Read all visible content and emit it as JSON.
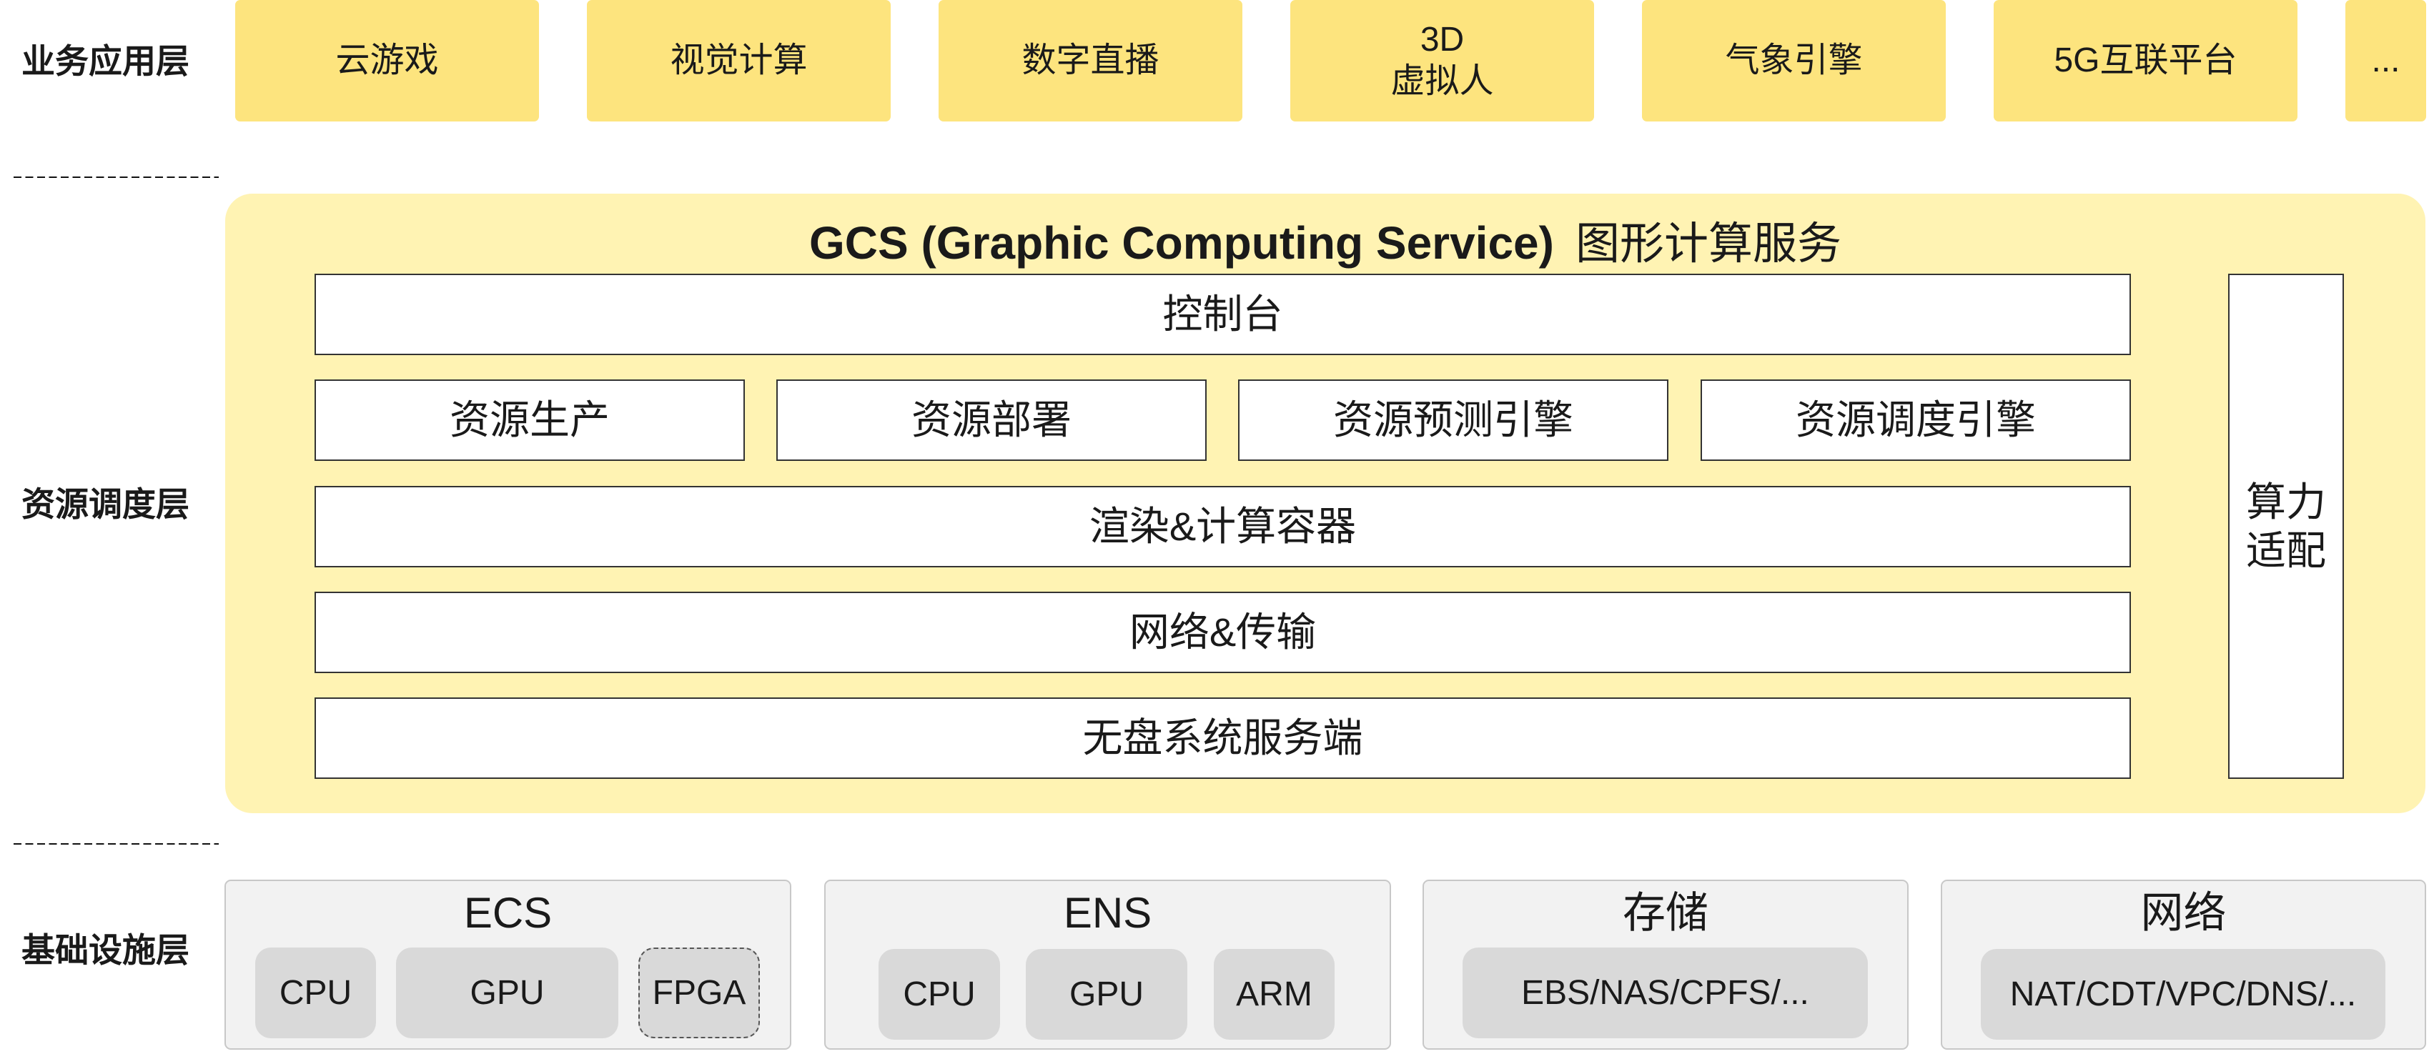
{
  "colors": {
    "app_box": "#FDE47E",
    "panel": "#FFF3B3",
    "module_fill": "#FFFFFF",
    "module_border": "#333333",
    "infra_box": "#F2F2F2",
    "infra_border": "#C8C8C8",
    "chip": "#D9D9D9",
    "chip_dashed_border": "#555555",
    "text": "#1A1A1A",
    "divider": "#111111"
  },
  "application_layer": {
    "label": "业务应用层",
    "items": [
      "云游戏",
      "视觉计算",
      "数字直播",
      "3D\n虚拟人",
      "气象引擎",
      "5G互联平台",
      "..."
    ]
  },
  "scheduling_layer": {
    "label": "资源调度层",
    "service": {
      "title_en": "GCS (Graphic Computing Service)",
      "title_cn": "图形计算服务",
      "console": "控制台",
      "modules": [
        "资源生产",
        "资源部署",
        "资源预测引擎",
        "资源调度引擎"
      ],
      "stack": [
        "渲染&计算容器",
        "网络&传输",
        "无盘系统服务端"
      ],
      "side": "算力\n适配"
    }
  },
  "infrastructure_layer": {
    "label": "基础设施层",
    "groups": [
      {
        "title": "ECS",
        "items": [
          "CPU",
          "GPU",
          "FPGA"
        ]
      },
      {
        "title": "ENS",
        "items": [
          "CPU",
          "GPU",
          "ARM"
        ]
      },
      {
        "title": "存储",
        "items": [
          "EBS/NAS/CPFS/..."
        ]
      },
      {
        "title": "网络",
        "items": [
          "NAT/CDT/VPC/DNS/..."
        ]
      }
    ]
  }
}
